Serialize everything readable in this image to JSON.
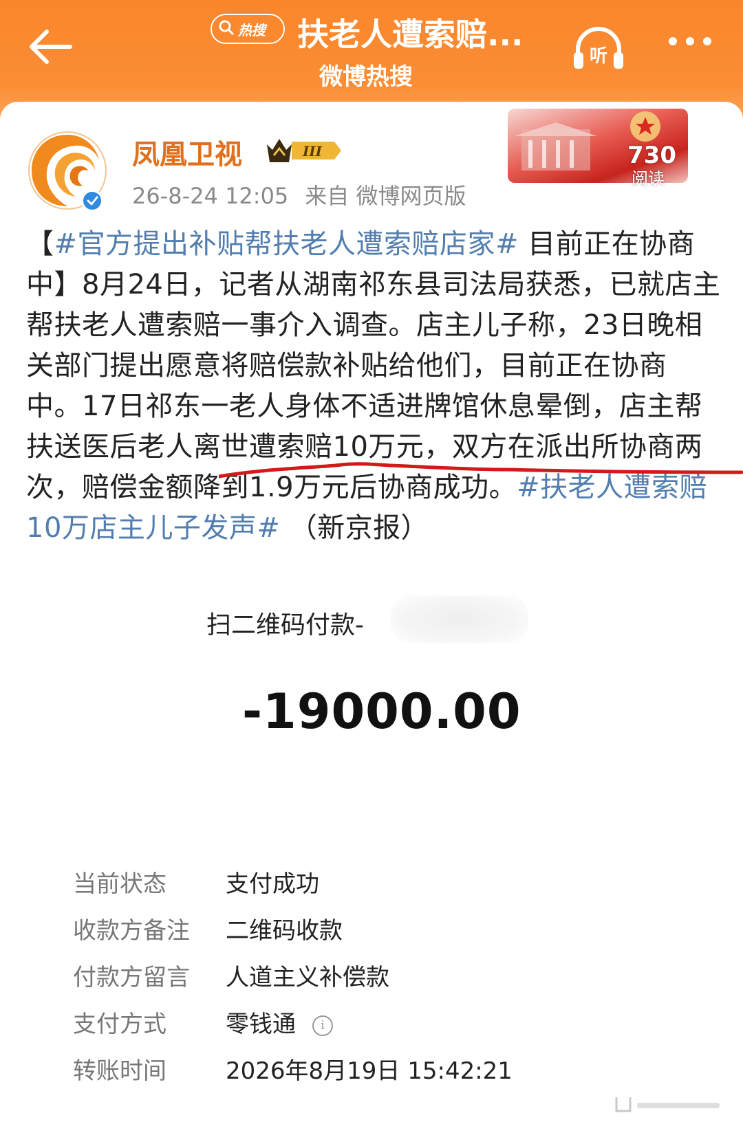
{
  "header": {
    "back_icon": "back-arrow-icon",
    "hot_badge": "热搜",
    "search_icon": "search-icon",
    "title": "扶老人遭索赔...",
    "subtitle": "微博热搜",
    "listen_label": "听",
    "more_icon": "more-dots-icon",
    "accent_color": "#f98a2f"
  },
  "post": {
    "author": "凤凰卫视",
    "badge_level": "III",
    "timestamp": "26-8-24 12:05",
    "source": "来自 微博网页版",
    "read_count": "730",
    "read_label": "阅读",
    "hashtag_1": "#官方提出补贴帮扶老人遭索赔店家#",
    "text_1": "目前正在协商中】8月24日，记者从湖南祁东县司法局获悉，已就店主帮扶老人遭索赔一事介入调查。店主儿子称，23日晚相关部门提出愿意将赔偿款补贴给他们，目前正在协商中。17日祁东一老人身体不适进牌馆休息晕倒，店主帮扶送医后老人离世遭索赔10万元，双方在派出所协商两次，赔偿金额降到1.9万元后协商成功。",
    "hashtag_2": "#扶老人遭索赔10万店主儿子发声#",
    "text_2": "（新京报）",
    "link_color": "#527eaf"
  },
  "payment": {
    "title": "扫二维码付款-",
    "amount": "-19000.00",
    "details": [
      {
        "label": "当前状态",
        "value": "支付成功"
      },
      {
        "label": "收款方备注",
        "value": "二维码收款"
      },
      {
        "label": "付款方留言",
        "value": "人道主义补偿款"
      },
      {
        "label": "支付方式",
        "value": "零钱通"
      },
      {
        "label": "转账时间",
        "value": "2026年8月19日 15:42:21"
      }
    ]
  }
}
